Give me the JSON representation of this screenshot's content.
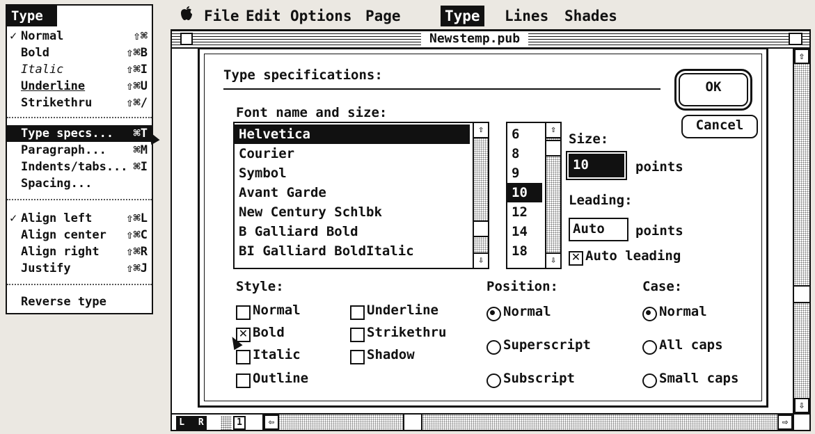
{
  "menubar": {
    "apple": "",
    "items": [
      "File",
      "Edit",
      "Options",
      "Page",
      "Type",
      "Lines",
      "Shades"
    ],
    "selected": "Type"
  },
  "type_menu": {
    "title": "Type",
    "group1": [
      {
        "check": "✓",
        "label": "Normal",
        "shortcut": "⇧⌘"
      },
      {
        "check": "",
        "label": "Bold",
        "shortcut": "⇧⌘B"
      },
      {
        "check": "",
        "label": "Italic",
        "shortcut": "⇧⌘I"
      },
      {
        "check": "",
        "label": "Underline",
        "shortcut": "⇧⌘U"
      },
      {
        "check": "",
        "label": "Strikethru",
        "shortcut": "⇧⌘/"
      }
    ],
    "group2": [
      {
        "check": "",
        "label": "Type specs...",
        "shortcut": "⌘T"
      },
      {
        "check": "",
        "label": "Paragraph...",
        "shortcut": "⌘M"
      },
      {
        "check": "",
        "label": "Indents/tabs...",
        "shortcut": "⌘I"
      },
      {
        "check": "",
        "label": "Spacing...",
        "shortcut": ""
      }
    ],
    "group3": [
      {
        "check": "✓",
        "label": "Align left",
        "shortcut": "⇧⌘L"
      },
      {
        "check": "",
        "label": "Align center",
        "shortcut": "⇧⌘C"
      },
      {
        "check": "",
        "label": "Align right",
        "shortcut": "⇧⌘R"
      },
      {
        "check": "",
        "label": "Justify",
        "shortcut": "⇧⌘J"
      }
    ],
    "group4": [
      {
        "check": "",
        "label": "Reverse type",
        "shortcut": ""
      }
    ],
    "highlighted": "Type specs..."
  },
  "document": {
    "title": "Newstemp.pub",
    "page_number": "1",
    "page_icons": [
      "L",
      "R"
    ]
  },
  "dialog": {
    "heading": "Type specifications:",
    "ok_label": "OK",
    "cancel_label": "Cancel",
    "font_section_label": "Font name and size:",
    "fonts": [
      "Helvetica",
      "Courier",
      "Symbol",
      "Avant Garde",
      "New Century Schlbk",
      "B Galliard Bold",
      "BI Galliard BoldItalic"
    ],
    "selected_font": "Helvetica",
    "sizes": [
      "6",
      "8",
      "9",
      "10",
      "12",
      "14",
      "18"
    ],
    "selected_size": "10",
    "size_label": "Size:",
    "size_value": "10",
    "size_unit": "points",
    "leading_label": "Leading:",
    "leading_value": "Auto",
    "leading_unit": "points",
    "auto_leading_label": "Auto leading",
    "auto_leading_checked": true,
    "style_label": "Style:",
    "styles": [
      {
        "label": "Normal",
        "checked": false
      },
      {
        "label": "Underline",
        "checked": false
      },
      {
        "label": "Bold",
        "checked": true
      },
      {
        "label": "Strikethru",
        "checked": false
      },
      {
        "label": "Italic",
        "checked": false
      },
      {
        "label": "Shadow",
        "checked": false
      },
      {
        "label": "Outline",
        "checked": false
      }
    ],
    "position_label": "Position:",
    "positions": [
      "Normal",
      "Superscript",
      "Subscript"
    ],
    "selected_position": "Normal",
    "case_label": "Case:",
    "cases": [
      "Normal",
      "All caps",
      "Small caps"
    ],
    "selected_case": "Normal"
  }
}
